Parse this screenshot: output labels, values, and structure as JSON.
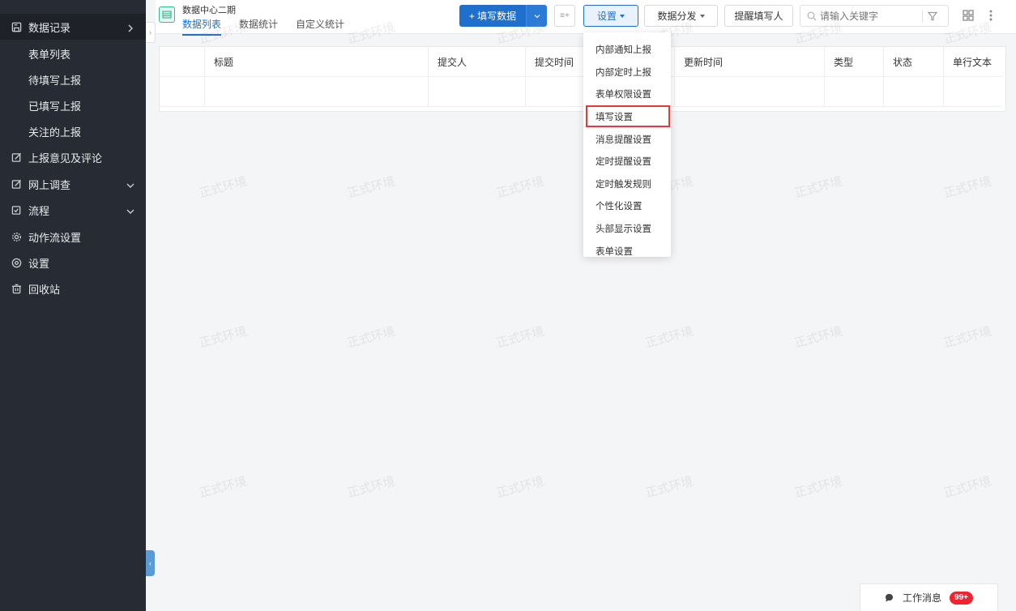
{
  "sidebar": {
    "items": [
      {
        "label": "数据记录",
        "icon": "save-icon",
        "active": true,
        "has_arrow": "right"
      },
      {
        "label": "表单列表",
        "sub": true
      },
      {
        "label": "待填写上报",
        "sub": true
      },
      {
        "label": "已填写上报",
        "sub": true
      },
      {
        "label": "关注的上报",
        "sub": true
      },
      {
        "label": "上报意见及评论",
        "icon": "comment-edit-icon"
      },
      {
        "label": "网上调查",
        "icon": "edit-icon",
        "has_arrow": "down"
      },
      {
        "label": "流程",
        "icon": "check-edit-icon",
        "has_arrow": "down"
      },
      {
        "label": "动作流设置",
        "icon": "gear-icon"
      },
      {
        "label": "设置",
        "icon": "settings-icon"
      },
      {
        "label": "回收站",
        "icon": "trash-icon"
      }
    ]
  },
  "header": {
    "app_title": "数据中心二期",
    "tabs": [
      {
        "label": "数据列表",
        "active": true
      },
      {
        "label": "数据统计"
      },
      {
        "label": "自定义统计"
      }
    ],
    "fill_button": "+ 填写数据",
    "settings_button": "设置",
    "distribute_button": "数据分发",
    "remind_button": "提醒填写人",
    "search_placeholder": "请输入关键字"
  },
  "table": {
    "columns": [
      "标题",
      "提交人",
      "提交时间",
      "更新时间",
      "类型",
      "状态",
      "单行文本"
    ]
  },
  "settings_menu": {
    "items": [
      "内部通知上报",
      "内部定时上报",
      "表单权限设置",
      "填写设置",
      "消息提醒设置",
      "定时提醒设置",
      "定时触发规则",
      "个性化设置",
      "头部显示设置",
      "表单设置"
    ],
    "highlighted_index": 3
  },
  "watermark": {
    "text": "正式环境"
  },
  "messages": {
    "label": "工作消息",
    "badge": "99+"
  },
  "colors": {
    "sidebar_bg": "#272b33",
    "primary": "#1f6fcc",
    "highlight_border": "#e53935",
    "badge": "#f0242f"
  }
}
